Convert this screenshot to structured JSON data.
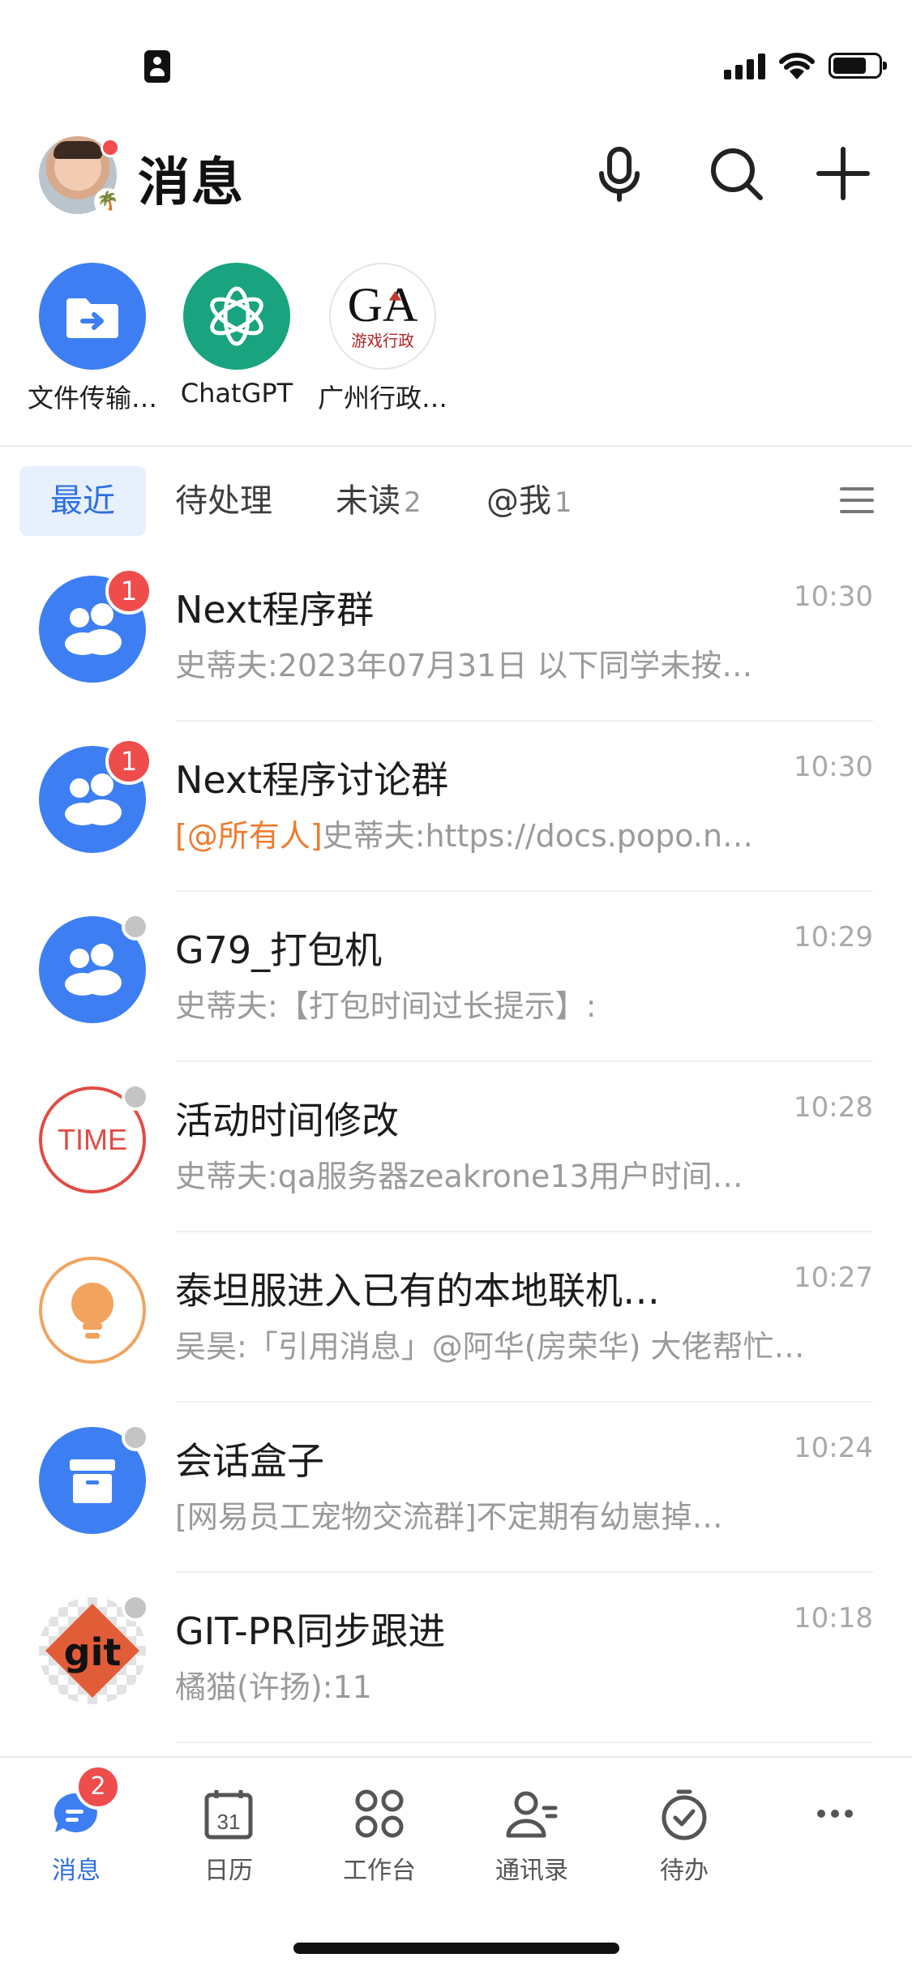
{
  "header": {
    "title": "消息",
    "avatar_badge_emoji": "🌴"
  },
  "pinned": [
    {
      "label": "文件传输…",
      "icon": "file-transfer-icon",
      "color": "#3d7ff3"
    },
    {
      "label": "ChatGPT",
      "icon": "chatgpt-logo-icon",
      "color": "#19a37f"
    },
    {
      "label": "广州行政…",
      "icon": "ga-game-admin-logo",
      "logo_text": "游戏行政"
    }
  ],
  "tabs": {
    "recent": "最近",
    "pending": "待处理",
    "unread": "未读",
    "unread_count": "2",
    "at_me": "@我",
    "at_me_count": "1"
  },
  "chats": [
    {
      "title": "Next程序群",
      "time": "10:30",
      "preview": "史蒂夫:2023年07月31日 以下同学未按…",
      "badge": "1",
      "icon": "group-icon"
    },
    {
      "title": "Next程序讨论群",
      "time": "10:30",
      "preview_at": "[@所有人]",
      "preview": "史蒂夫:https://docs.popo.n…",
      "badge": "1",
      "icon": "group-icon"
    },
    {
      "title": "G79_打包机",
      "time": "10:29",
      "preview": "史蒂夫:【打包时间过长提示】:",
      "icon": "group-icon"
    },
    {
      "title": "活动时间修改",
      "time": "10:28",
      "preview": "史蒂夫:qa服务器zeakrone13用户时间…",
      "icon": "time-logo",
      "logo_text": "TIME"
    },
    {
      "title": "泰坦服进入已有的本地联机…",
      "time": "10:27",
      "preview": "吴昊:「引用消息」@阿华(房荣华) 大佬帮忙…",
      "icon": "lightbulb-icon"
    },
    {
      "title": "会话盒子",
      "time": "10:24",
      "preview": "[网易员工宠物交流群]不定期有幼崽掉…",
      "icon": "box-icon"
    },
    {
      "title": "GIT-PR同步跟进",
      "time": "10:18",
      "preview": "橘猫(许扬):11",
      "icon": "git-logo",
      "logo_text": "git"
    }
  ],
  "tabbar": [
    {
      "label": "消息",
      "icon": "message-icon",
      "badge": "2",
      "active": true
    },
    {
      "label": "日历",
      "icon": "calendar-icon",
      "day": "31"
    },
    {
      "label": "工作台",
      "icon": "workbench-icon"
    },
    {
      "label": "通讯录",
      "icon": "contacts-icon"
    },
    {
      "label": "待办",
      "icon": "todo-timer-icon"
    },
    {
      "label": "",
      "icon": "more-icon"
    }
  ],
  "colors": {
    "accent": "#2e6fe0",
    "badge": "#ef4c4c",
    "mention": "#ef7b2e",
    "group_icon": "#3d7ff3"
  }
}
